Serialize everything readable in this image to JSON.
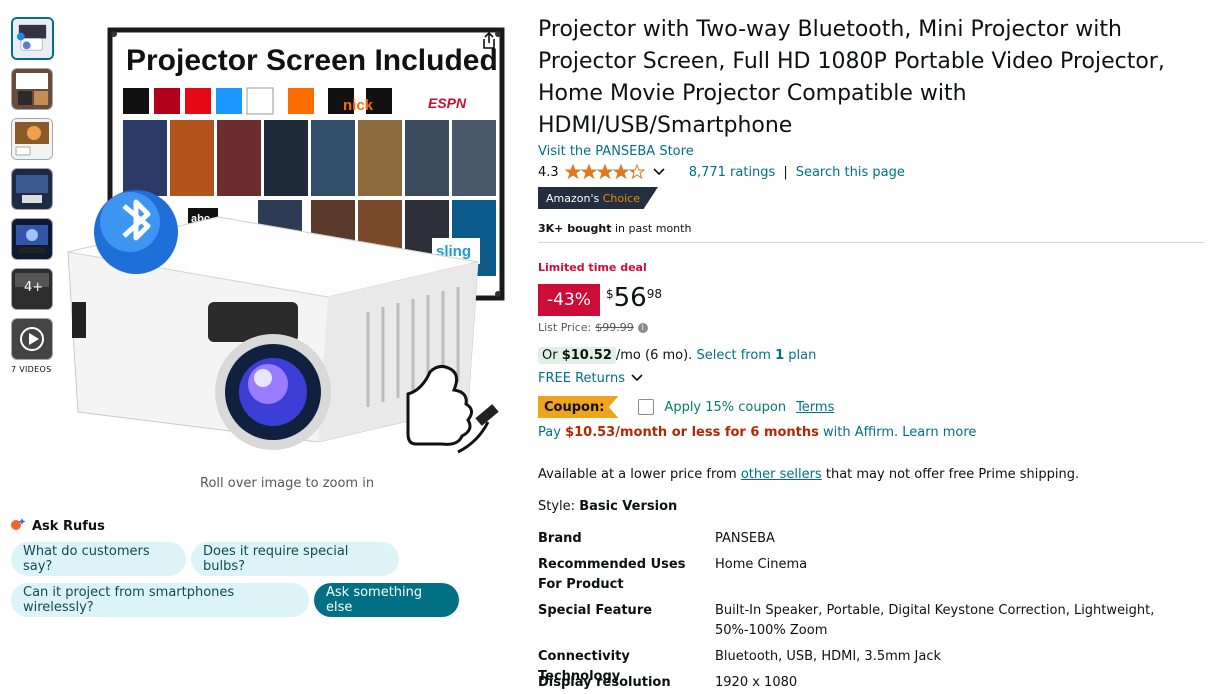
{
  "gallery": {
    "video_count_label": "7 VIDEOS",
    "more_count_label": "4+",
    "zoom_hint": "Roll over image to zoom in"
  },
  "main_image": {
    "banner_text": "Projector Screen Included",
    "channel_logos": [
      "HBO NOW",
      "SHOWTIME",
      "NETFLIX",
      "prime video",
      "PBS KIDS",
      "nick",
      "vault",
      "ESPN",
      "abc",
      "sling"
    ]
  },
  "rufus": {
    "title": "Ask Rufus",
    "chips": [
      "What do customers say?",
      "Does it require special bulbs?",
      "Can it project from smartphones wirelessly?",
      "Ask something else"
    ]
  },
  "product": {
    "title": "Projector with Two-way Bluetooth, Mini Projector with Projector Screen, Full HD 1080P Portable Video Projector, Home Movie Projector Compatible with HDMI/USB/Smartphone",
    "store_link": "Visit the PANSEBA Store",
    "rating": "4.3",
    "rating_stars": 4.3,
    "ratings_count": "8,771 ratings",
    "search_page": "Search this page",
    "badge_amazons": "Amazon's",
    "badge_choice": "Choice",
    "bought_strong": "3K+ bought",
    "bought_rest": "in past month"
  },
  "pricing": {
    "deal_label": "Limited time deal",
    "discount": "-43%",
    "currency": "$",
    "whole": "56",
    "fraction": "98",
    "list_price_label": "List Price:",
    "list_price": "$99.99",
    "monthly_or": "Or",
    "monthly_amount": "$10.52",
    "monthly_term": "/mo (6 mo).",
    "monthly_select_prefix": "Select from",
    "monthly_select_count": "1",
    "monthly_select_suffix": "plan",
    "free_returns": "FREE Returns",
    "coupon_label": "Coupon:",
    "coupon_apply": "Apply 15% coupon",
    "coupon_terms": "Terms",
    "affirm_prefix": "Pay",
    "affirm_bold": "$10.53/month or less for 6 months",
    "affirm_suffix": "with Affirm.",
    "affirm_learn": "Learn more",
    "lower_price_prefix": "Available at a lower price from",
    "lower_price_link": "other sellers",
    "lower_price_suffix": "that may not offer free Prime shipping.",
    "style_label": "Style:",
    "style_value": "Basic Version"
  },
  "specs": [
    {
      "label": "Brand",
      "value": "PANSEBA"
    },
    {
      "label": "Recommended Uses For Product",
      "value": "Home Cinema"
    },
    {
      "label": "Special Feature",
      "value": "Built-In Speaker, Portable, Digital Keystone Correction, Lightweight, 50%-100% Zoom"
    },
    {
      "label": "Connectivity Technology",
      "value": "Bluetooth, USB, HDMI, 3.5mm Jack"
    },
    {
      "label": "Display resolution",
      "value": "1920 x 1080"
    }
  ],
  "colors": {
    "link": "#007185",
    "deal_red": "#cc0c39",
    "badge_dark": "#232f3e",
    "choice_orange": "#f08804",
    "coupon_orange": "#f0a31c",
    "chip_bg": "#dcf4f8"
  }
}
